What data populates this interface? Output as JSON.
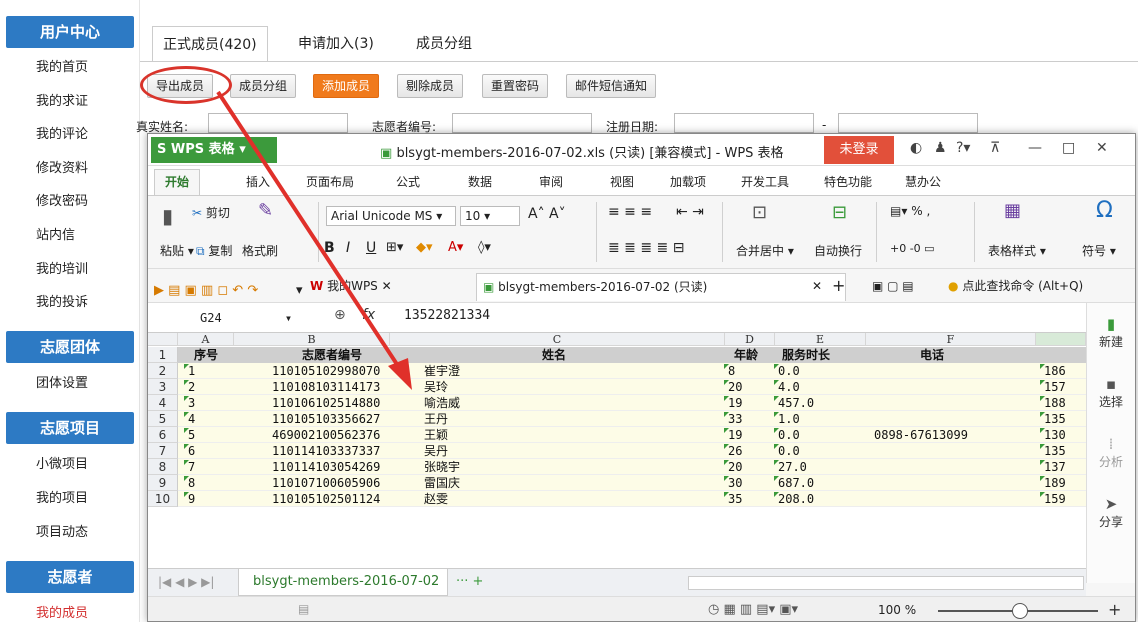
{
  "sidebar": {
    "sections": [
      {
        "title": "用户中心",
        "items": [
          "我的首页",
          "我的求证",
          "我的评论",
          "修改资料",
          "修改密码",
          "站内信",
          "我的培训",
          "我的投诉"
        ]
      },
      {
        "title": "志愿团体",
        "items": [
          "团体设置"
        ]
      },
      {
        "title": "志愿项目",
        "items": [
          "小微项目",
          "我的项目",
          "项目动态"
        ]
      },
      {
        "title": "志愿者",
        "items": [
          "我的成员"
        ]
      }
    ]
  },
  "tabs": [
    "正式成员(420)",
    "申请加入(3)",
    "成员分组"
  ],
  "toolbar": {
    "export": "导出成员",
    "group": "成员分组",
    "add": "添加成员",
    "remove": "剔除成员",
    "reset": "重置密码",
    "notify": "邮件短信通知"
  },
  "filters": {
    "realname": "真实姓名:",
    "volunteer_no": "志愿者编号:",
    "reg_date": "注册日期:",
    "dash": "-"
  },
  "wps": {
    "app": "WPS 表格",
    "title": "blsygt-members-2016-07-02.xls (只读) [兼容模式] - WPS 表格",
    "login": "未登录",
    "menus": [
      "开始",
      "插入",
      "页面布局",
      "公式",
      "数据",
      "审阅",
      "视图",
      "加载项",
      "开发工具",
      "特色功能",
      "慧办公"
    ],
    "ribbon": {
      "cut": "剪切",
      "paste": "粘贴",
      "copy": "复制",
      "format_painter": "格式刷",
      "font": "Arial Unicode MS",
      "size": "10",
      "merge": "合并居中",
      "wrap": "自动换行",
      "percent": "%",
      "table_style": "表格样式",
      "symbol": "符号"
    },
    "quick": {
      "mywps": "我的WPS",
      "doc": "blsygt-members-2016-07-02 (只读)",
      "search": "点此查找命令 (Alt+Q)"
    },
    "cellref": "G24",
    "formula": "13522821334",
    "columns": [
      "A",
      "B",
      "C",
      "D",
      "E",
      "F"
    ],
    "headers": {
      "seq": "序号",
      "no": "志愿者编号",
      "name": "姓名",
      "age": "年龄",
      "hours": "服务时长",
      "phone": "电话"
    },
    "rows": [
      {
        "r": "1"
      },
      {
        "r": "2",
        "seq": "1",
        "no": "110105102998070",
        "name": "崔宇澄",
        "age": "8",
        "hours": "0.0",
        "phone": "",
        "g": "186"
      },
      {
        "r": "3",
        "seq": "2",
        "no": "110108103114173",
        "name": "吴玲",
        "age": "20",
        "hours": "4.0",
        "phone": "",
        "g": "157"
      },
      {
        "r": "4",
        "seq": "3",
        "no": "110106102514880",
        "name": "喻浩威",
        "age": "19",
        "hours": "457.0",
        "phone": "",
        "g": "188"
      },
      {
        "r": "5",
        "seq": "4",
        "no": "110105103356627",
        "name": "王丹",
        "age": "33",
        "hours": "1.0",
        "phone": "",
        "g": "135"
      },
      {
        "r": "6",
        "seq": "5",
        "no": "469002100562376",
        "name": "王颖",
        "age": "19",
        "hours": "0.0",
        "phone": "0898-67613099",
        "g": "130"
      },
      {
        "r": "7",
        "seq": "6",
        "no": "110114103337337",
        "name": "吴丹",
        "age": "26",
        "hours": "0.0",
        "phone": "",
        "g": "135"
      },
      {
        "r": "8",
        "seq": "7",
        "no": "110114103054269",
        "name": "张晓宇",
        "age": "20",
        "hours": "27.0",
        "phone": "",
        "g": "137"
      },
      {
        "r": "9",
        "seq": "8",
        "no": "110107100605906",
        "name": "雷国庆",
        "age": "30",
        "hours": "687.0",
        "phone": "",
        "g": "189"
      },
      {
        "r": "10",
        "seq": "9",
        "no": "110105102501124",
        "name": "赵雯",
        "age": "35",
        "hours": "208.0",
        "phone": "",
        "g": "159"
      }
    ],
    "pane": [
      "新建",
      "选择",
      "分析",
      "分享"
    ],
    "sheet": "blsygt-members-2016-07-02",
    "zoom": "100 %"
  }
}
